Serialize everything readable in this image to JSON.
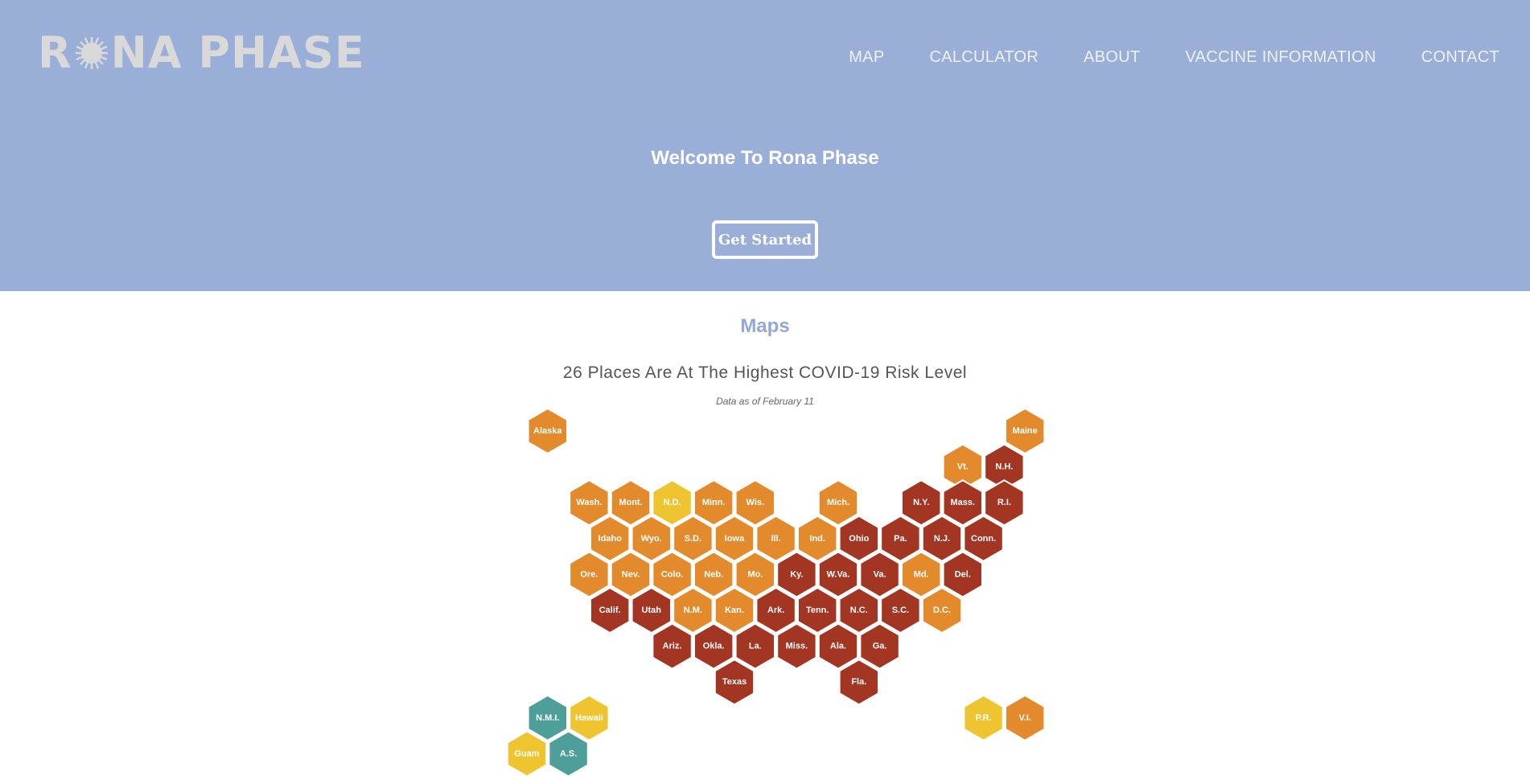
{
  "header": {
    "logo_text_left": "R",
    "logo_text_right": "NA PHASE",
    "nav": [
      {
        "label": "MAP"
      },
      {
        "label": "CALCULATOR"
      },
      {
        "label": "ABOUT"
      },
      {
        "label": "VACCINE INFORMATION"
      },
      {
        "label": "CONTACT"
      }
    ]
  },
  "hero": {
    "welcome": "Welcome To Rona Phase",
    "cta_label": "Get Started"
  },
  "maps": {
    "section_title": "Maps",
    "headline": "26 Places Are At The Highest COVID-19 Risk Level",
    "date_note": "Data as of February 11"
  },
  "colors": {
    "hero_bg": "#9aafd8",
    "highest": "#a33523",
    "high": "#e38b2c",
    "medium": "#efc431",
    "low": "#4e9e9a"
  },
  "tiles": [
    {
      "label": "Alaska",
      "col": 1,
      "row": 0,
      "level": "high"
    },
    {
      "label": "Maine",
      "col": 24,
      "row": 0,
      "level": "high"
    },
    {
      "label": "Vt.",
      "col": 21,
      "row": 1,
      "level": "high"
    },
    {
      "label": "N.H.",
      "col": 23,
      "row": 1,
      "level": "highest"
    },
    {
      "label": "Wash.",
      "col": 3,
      "row": 2,
      "level": "high"
    },
    {
      "label": "Mont.",
      "col": 5,
      "row": 2,
      "level": "high"
    },
    {
      "label": "N.D.",
      "col": 7,
      "row": 2,
      "level": "medium"
    },
    {
      "label": "Minn.",
      "col": 9,
      "row": 2,
      "level": "high"
    },
    {
      "label": "Wis.",
      "col": 11,
      "row": 2,
      "level": "high"
    },
    {
      "label": "Mich.",
      "col": 15,
      "row": 2,
      "level": "high"
    },
    {
      "label": "N.Y.",
      "col": 19,
      "row": 2,
      "level": "highest"
    },
    {
      "label": "Mass.",
      "col": 21,
      "row": 2,
      "level": "highest"
    },
    {
      "label": "R.I.",
      "col": 23,
      "row": 2,
      "level": "highest"
    },
    {
      "label": "Idaho",
      "col": 4,
      "row": 3,
      "level": "high"
    },
    {
      "label": "Wyo.",
      "col": 6,
      "row": 3,
      "level": "high"
    },
    {
      "label": "S.D.",
      "col": 8,
      "row": 3,
      "level": "high"
    },
    {
      "label": "Iowa",
      "col": 10,
      "row": 3,
      "level": "high"
    },
    {
      "label": "Ill.",
      "col": 12,
      "row": 3,
      "level": "high"
    },
    {
      "label": "Ind.",
      "col": 14,
      "row": 3,
      "level": "high"
    },
    {
      "label": "Ohio",
      "col": 16,
      "row": 3,
      "level": "highest"
    },
    {
      "label": "Pa.",
      "col": 18,
      "row": 3,
      "level": "highest"
    },
    {
      "label": "N.J.",
      "col": 20,
      "row": 3,
      "level": "highest"
    },
    {
      "label": "Conn.",
      "col": 22,
      "row": 3,
      "level": "highest"
    },
    {
      "label": "Ore.",
      "col": 3,
      "row": 4,
      "level": "high"
    },
    {
      "label": "Nev.",
      "col": 5,
      "row": 4,
      "level": "high"
    },
    {
      "label": "Colo.",
      "col": 7,
      "row": 4,
      "level": "high"
    },
    {
      "label": "Neb.",
      "col": 9,
      "row": 4,
      "level": "high"
    },
    {
      "label": "Mo.",
      "col": 11,
      "row": 4,
      "level": "high"
    },
    {
      "label": "Ky.",
      "col": 13,
      "row": 4,
      "level": "highest"
    },
    {
      "label": "W.Va.",
      "col": 15,
      "row": 4,
      "level": "highest"
    },
    {
      "label": "Va.",
      "col": 17,
      "row": 4,
      "level": "highest"
    },
    {
      "label": "Md.",
      "col": 19,
      "row": 4,
      "level": "high"
    },
    {
      "label": "Del.",
      "col": 21,
      "row": 4,
      "level": "highest"
    },
    {
      "label": "Calif.",
      "col": 4,
      "row": 5,
      "level": "highest"
    },
    {
      "label": "Utah",
      "col": 6,
      "row": 5,
      "level": "highest"
    },
    {
      "label": "N.M.",
      "col": 8,
      "row": 5,
      "level": "high"
    },
    {
      "label": "Kan.",
      "col": 10,
      "row": 5,
      "level": "high"
    },
    {
      "label": "Ark.",
      "col": 12,
      "row": 5,
      "level": "highest"
    },
    {
      "label": "Tenn.",
      "col": 14,
      "row": 5,
      "level": "highest"
    },
    {
      "label": "N.C.",
      "col": 16,
      "row": 5,
      "level": "highest"
    },
    {
      "label": "S.C.",
      "col": 18,
      "row": 5,
      "level": "highest"
    },
    {
      "label": "D.C.",
      "col": 20,
      "row": 5,
      "level": "high"
    },
    {
      "label": "Ariz.",
      "col": 7,
      "row": 6,
      "level": "highest"
    },
    {
      "label": "Okla.",
      "col": 9,
      "row": 6,
      "level": "highest"
    },
    {
      "label": "La.",
      "col": 11,
      "row": 6,
      "level": "highest"
    },
    {
      "label": "Miss.",
      "col": 13,
      "row": 6,
      "level": "highest"
    },
    {
      "label": "Ala.",
      "col": 15,
      "row": 6,
      "level": "highest"
    },
    {
      "label": "Ga.",
      "col": 17,
      "row": 6,
      "level": "highest"
    },
    {
      "label": "Texas",
      "col": 10,
      "row": 7,
      "level": "highest"
    },
    {
      "label": "Fla.",
      "col": 16,
      "row": 7,
      "level": "highest"
    },
    {
      "label": "N.M.I.",
      "col": 1,
      "row": 8,
      "level": "low"
    },
    {
      "label": "Hawaii",
      "col": 3,
      "row": 8,
      "level": "medium"
    },
    {
      "label": "P.R.",
      "col": 22,
      "row": 8,
      "level": "medium"
    },
    {
      "label": "V.I.",
      "col": 24,
      "row": 8,
      "level": "high"
    },
    {
      "label": "Guam",
      "col": 0,
      "row": 9,
      "level": "medium"
    },
    {
      "label": "A.S.",
      "col": 2,
      "row": 9,
      "level": "low"
    }
  ]
}
